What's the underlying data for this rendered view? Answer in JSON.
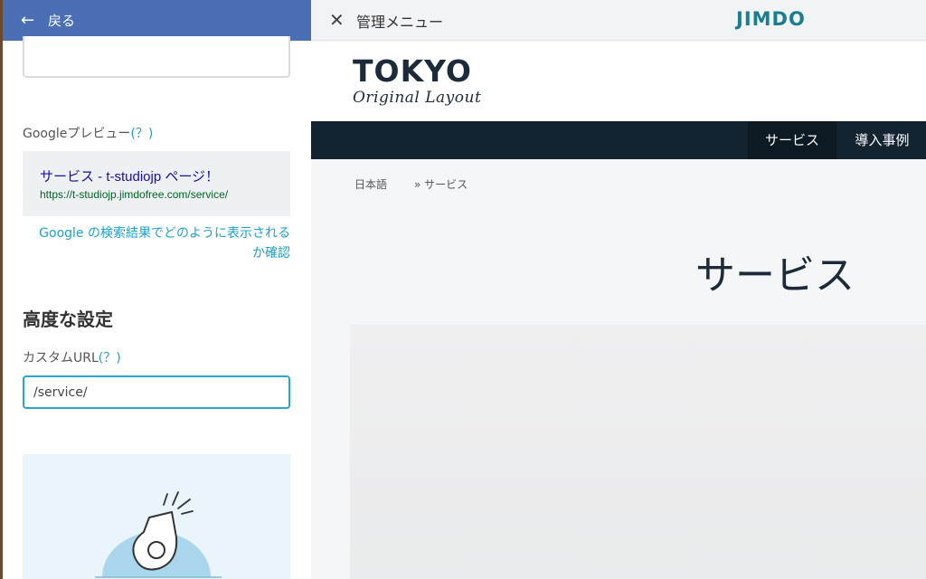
{
  "left_panel": {
    "back_label": "戻る",
    "google_preview": {
      "label": "Googleプレビュー",
      "help": "(？)",
      "title": "サービス - t-studiojp ページ！",
      "url": "https://t-studiojp.jimdofree.com/service/",
      "check_link_line1": "Google の検索結果でどのように表示される",
      "check_link_line2": "か確認"
    },
    "advanced": {
      "heading": "高度な設定",
      "custom_url_label": "カスタムURL",
      "help": "(？)",
      "custom_url_value": "/service/"
    }
  },
  "topbar": {
    "admin_menu_label": "管理メニュー",
    "brand": "JIMDO"
  },
  "site": {
    "logo_main": "TOKYO",
    "logo_sub": "Original Layout",
    "nav": [
      {
        "label": "サービス",
        "active": true
      },
      {
        "label": "導入事例",
        "active": false
      }
    ],
    "breadcrumb": {
      "home": "日本語",
      "separator": "»",
      "current": "サービス"
    },
    "page_title": "サービス"
  },
  "colors": {
    "back_bar": "#4a6fb5",
    "accent": "#28a7cf",
    "nav_bg": "#132430",
    "jimdo_brand": "#1a7e8f"
  }
}
